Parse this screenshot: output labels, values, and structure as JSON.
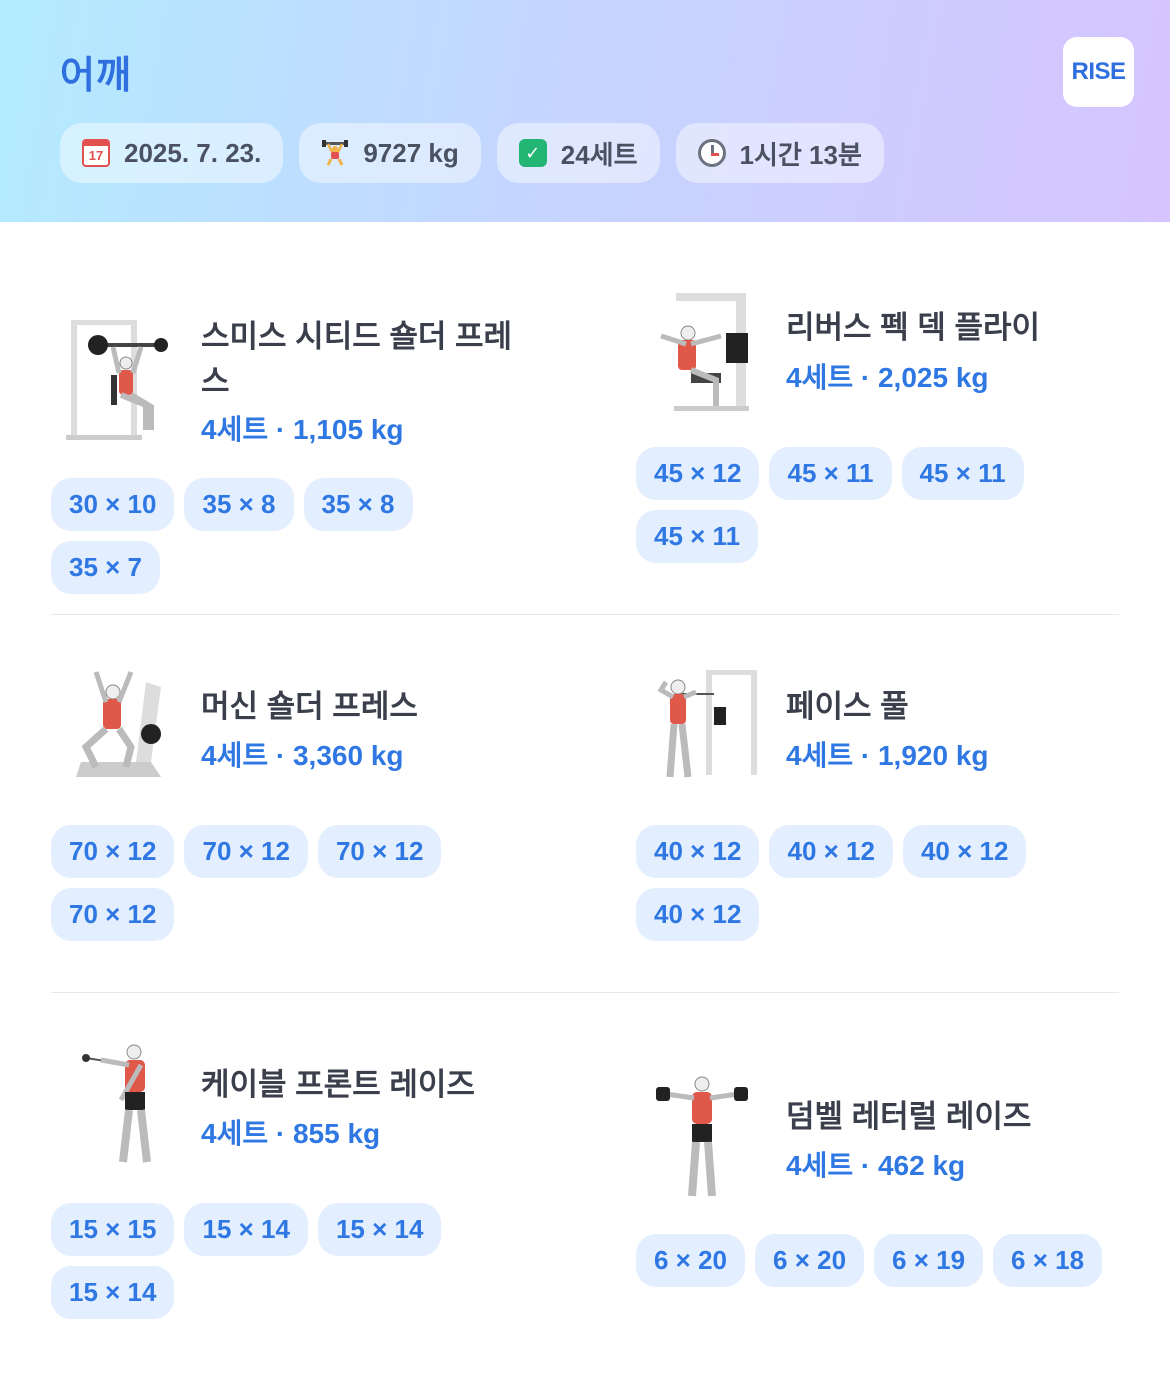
{
  "header": {
    "title": "어깨",
    "logo": "RISE",
    "stats": {
      "date": "2025. 7. 23.",
      "volume": "9727 kg",
      "sets": "24세트",
      "duration": "1시간 13분"
    }
  },
  "exercises": [
    {
      "name": "스미스 시티드 숄더 프레스",
      "summary": "4세트 · 1,105 kg",
      "sets": [
        "30 × 10",
        "35 × 8",
        "35 × 8",
        "35 × 7"
      ]
    },
    {
      "name": "리버스 펙 덱 플라이",
      "summary": "4세트 · 2,025 kg",
      "sets": [
        "45 × 12",
        "45 × 11",
        "45 × 11",
        "45 × 11"
      ]
    },
    {
      "name": "머신 숄더 프레스",
      "summary": "4세트 · 3,360 kg",
      "sets": [
        "70 × 12",
        "70 × 12",
        "70 × 12",
        "70 × 12"
      ]
    },
    {
      "name": "페이스 풀",
      "summary": "4세트 · 1,920 kg",
      "sets": [
        "40 × 12",
        "40 × 12",
        "40 × 12",
        "40 × 12"
      ]
    },
    {
      "name": "케이블 프론트 레이즈",
      "summary": "4세트 · 855 kg",
      "sets": [
        "15 × 15",
        "15 × 14",
        "15 × 14",
        "15 × 14"
      ]
    },
    {
      "name": "덤벨 레터럴 레이즈",
      "summary": "4세트 · 462 kg",
      "sets": [
        "6 × 20",
        "6 × 20",
        "6 × 19",
        "6 × 18"
      ]
    }
  ],
  "colors": {
    "accent": "#2f78e3",
    "chip_bg": "#e3eeff",
    "muscle": "#e0584a"
  }
}
